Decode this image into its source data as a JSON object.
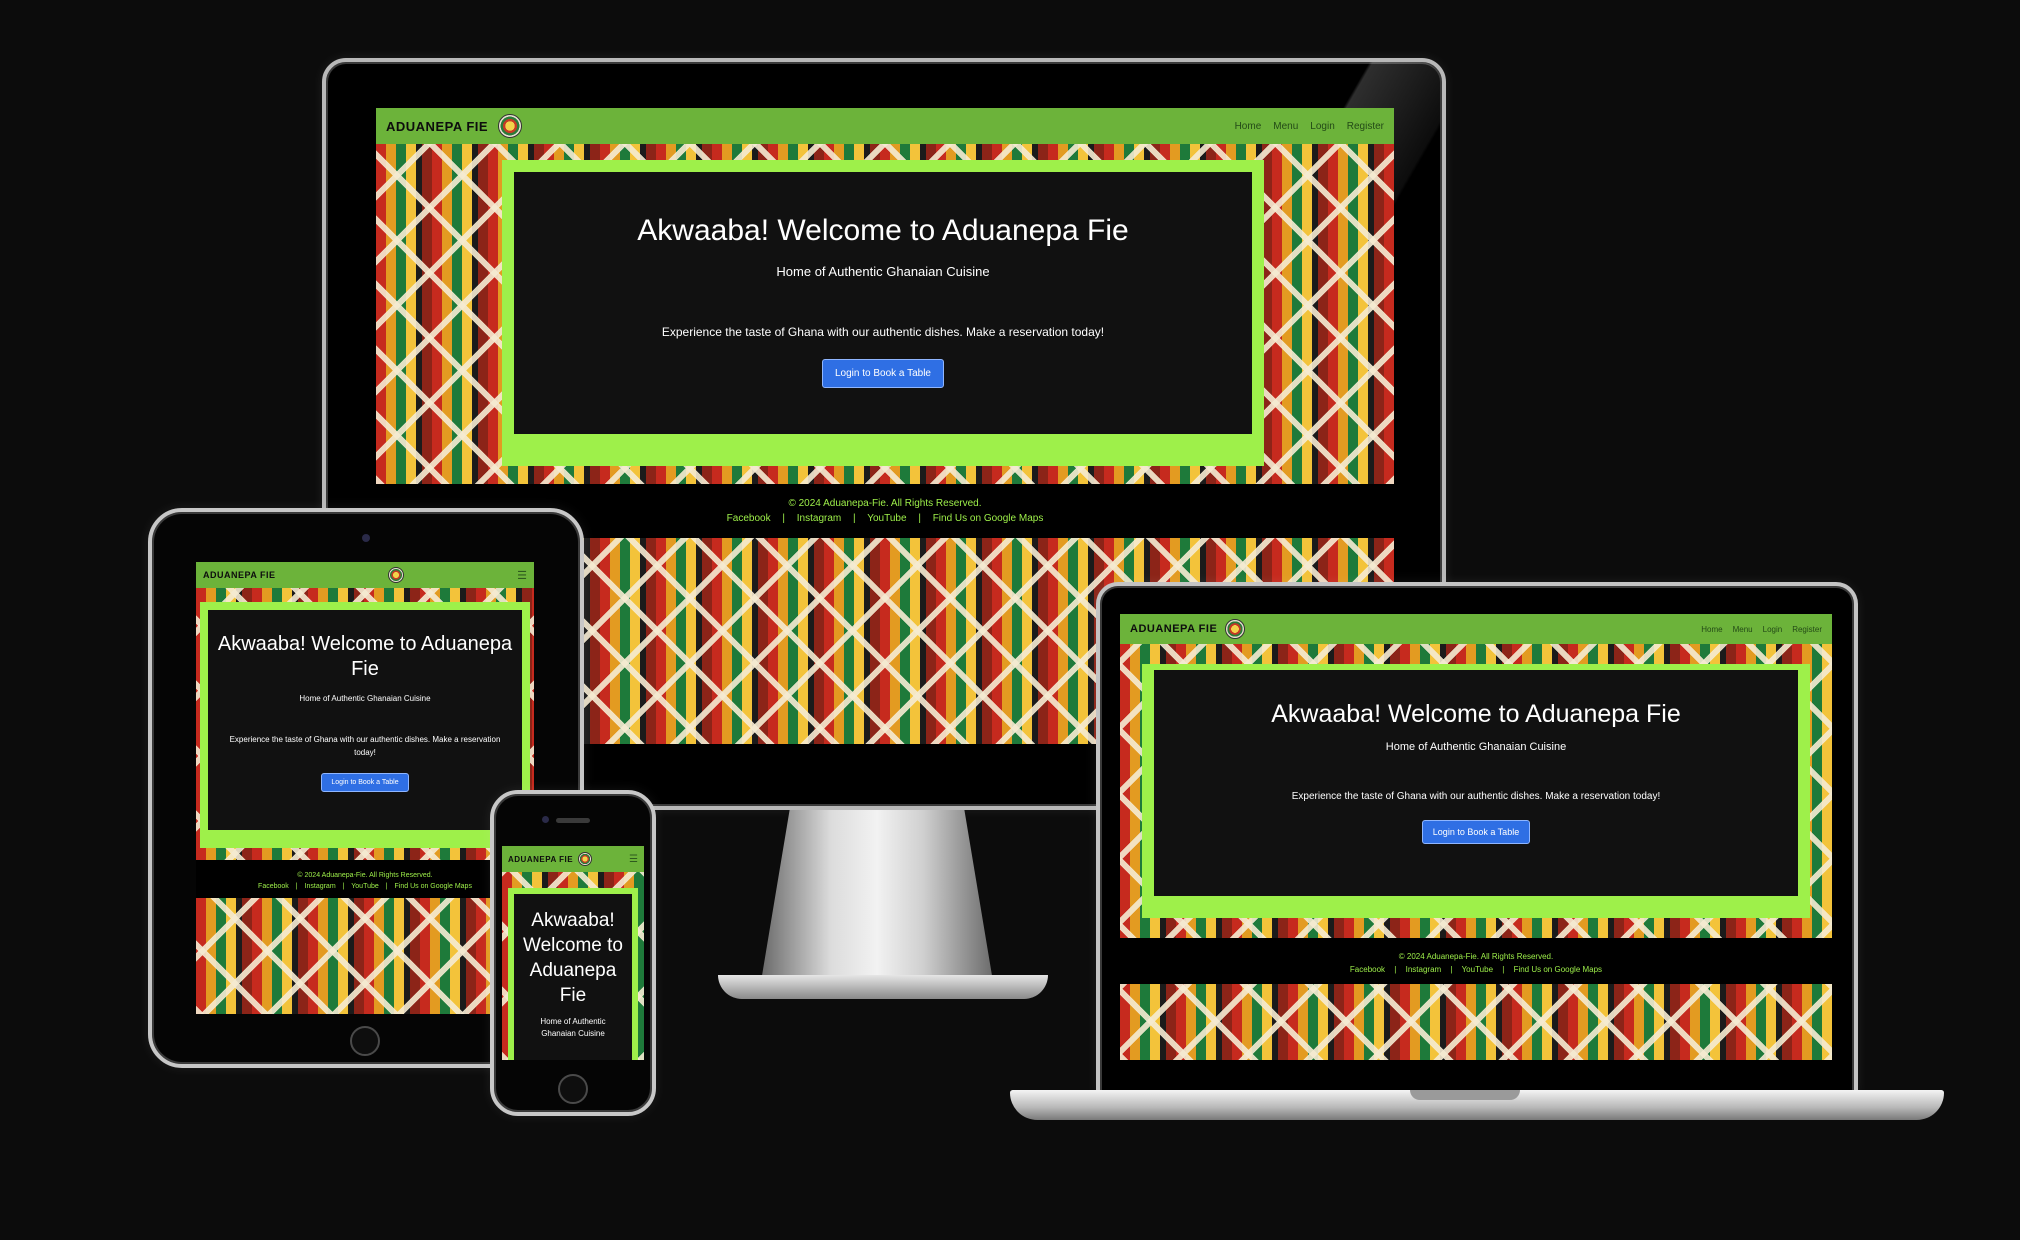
{
  "site": {
    "brand": "ADUANEPA FIE",
    "nav": [
      "Home",
      "Menu",
      "Login",
      "Register"
    ],
    "menu_toggle_icon": "hamburger-icon",
    "hero": {
      "title": "Akwaaba! Welcome to Aduanepa Fie",
      "subtitle": "Home of Authentic Ghanaian Cuisine",
      "body": "Experience the taste of Ghana with our authentic dishes. Make a reservation today!",
      "button": "Login to Book a Table"
    },
    "footer": {
      "copyright": "© 2024 Aduanepa-Fie. All Rights Reserved.",
      "links": [
        "Facebook",
        "Instagram",
        "YouTube",
        "Find Us on Google Maps"
      ],
      "separator": "|"
    }
  },
  "phone": {
    "title_lines": [
      "Akwaaba!",
      "Welcome to",
      "Aduanepa",
      "Fie"
    ],
    "subtitle_lines": [
      "Home of Authentic",
      "Ghanaian Cuisine"
    ]
  },
  "colors": {
    "nav": "#6cb33a",
    "hero_border": "#9ef04a",
    "button": "#2f6fe4",
    "footer_text": "#9ef04a",
    "background": "#0c0c0c"
  }
}
